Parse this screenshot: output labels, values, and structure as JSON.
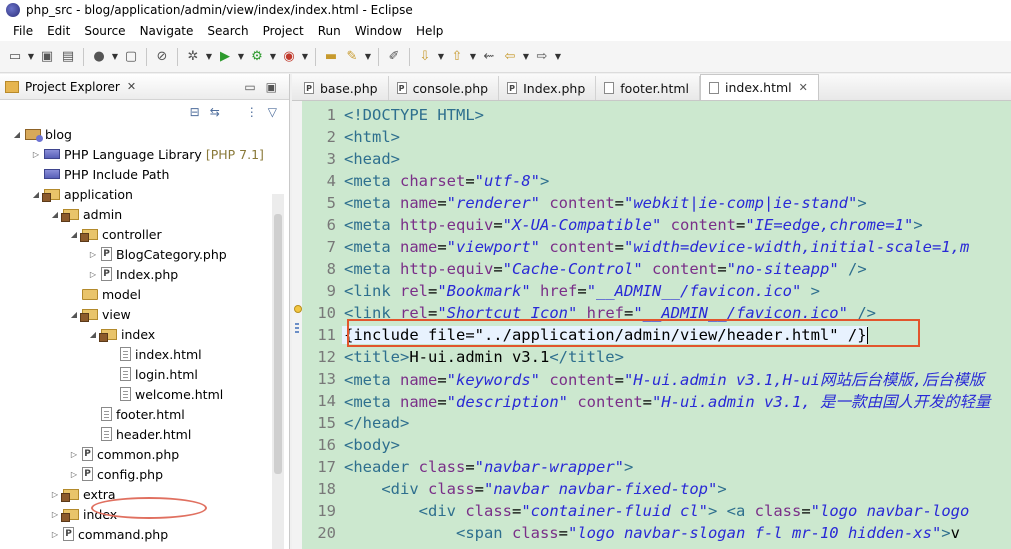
{
  "window": {
    "title": "php_src - blog/application/admin/view/index/index.html - Eclipse"
  },
  "menu": [
    "File",
    "Edit",
    "Source",
    "Navigate",
    "Search",
    "Project",
    "Run",
    "Window",
    "Help"
  ],
  "explorer": {
    "title": "Project Explorer",
    "tree": [
      {
        "label": "blog",
        "depth": 0,
        "expand": "open",
        "icon": "proj"
      },
      {
        "label": "PHP Language Library",
        "suffix": "[PHP 7.1]",
        "depth": 1,
        "expand": "closed",
        "icon": "lib"
      },
      {
        "label": "PHP Include Path",
        "depth": 1,
        "expand": "none",
        "icon": "lib"
      },
      {
        "label": "application",
        "depth": 1,
        "expand": "open",
        "icon": "pkg"
      },
      {
        "label": "admin",
        "depth": 2,
        "expand": "open",
        "icon": "pkg"
      },
      {
        "label": "controller",
        "depth": 3,
        "expand": "open",
        "icon": "pkg"
      },
      {
        "label": "BlogCategory.php",
        "depth": 4,
        "expand": "closed",
        "icon": "file-p"
      },
      {
        "label": "Index.php",
        "depth": 4,
        "expand": "closed",
        "icon": "file-p"
      },
      {
        "label": "model",
        "depth": 3,
        "expand": "none",
        "icon": "folder"
      },
      {
        "label": "view",
        "depth": 3,
        "expand": "open",
        "icon": "pkg"
      },
      {
        "label": "index",
        "depth": 4,
        "expand": "open",
        "icon": "pkg"
      },
      {
        "label": "index.html",
        "depth": 5,
        "expand": "none",
        "icon": "file-h"
      },
      {
        "label": "login.html",
        "depth": 5,
        "expand": "none",
        "icon": "file-h"
      },
      {
        "label": "welcome.html",
        "depth": 5,
        "expand": "none",
        "icon": "file-h"
      },
      {
        "label": "footer.html",
        "depth": 4,
        "expand": "none",
        "icon": "file-h"
      },
      {
        "label": "header.html",
        "depth": 4,
        "expand": "none",
        "icon": "file-h"
      },
      {
        "label": "common.php",
        "depth": 3,
        "expand": "closed",
        "icon": "file-p"
      },
      {
        "label": "config.php",
        "depth": 3,
        "expand": "closed",
        "icon": "file-p"
      },
      {
        "label": "extra",
        "depth": 2,
        "expand": "closed",
        "icon": "pkg"
      },
      {
        "label": "index",
        "depth": 2,
        "expand": "closed",
        "icon": "pkg"
      },
      {
        "label": "command.php",
        "depth": 2,
        "expand": "closed",
        "icon": "file-p"
      }
    ]
  },
  "editor": {
    "tabs": [
      {
        "label": "base.php",
        "icon": "file-p",
        "active": false
      },
      {
        "label": "console.php",
        "icon": "file-p",
        "active": false
      },
      {
        "label": "Index.php",
        "icon": "file-p",
        "active": false
      },
      {
        "label": "footer.html",
        "icon": "file-h",
        "active": false
      },
      {
        "label": "index.html",
        "icon": "file-h",
        "active": true
      }
    ],
    "current_line": 11,
    "lines": [
      [
        [
          "tag",
          "<!DOCTYPE HTML>"
        ]
      ],
      [
        [
          "tag",
          "<html>"
        ]
      ],
      [
        [
          "tag",
          "<head>"
        ]
      ],
      [
        [
          "tag",
          "<meta "
        ],
        [
          "attr",
          "charset"
        ],
        [
          "txt",
          "="
        ],
        [
          "val",
          "\"utf-8\""
        ],
        [
          "tag",
          ">"
        ]
      ],
      [
        [
          "tag",
          "<meta "
        ],
        [
          "attr",
          "name"
        ],
        [
          "txt",
          "="
        ],
        [
          "val",
          "\"renderer\""
        ],
        [
          "txt",
          " "
        ],
        [
          "attr",
          "content"
        ],
        [
          "txt",
          "="
        ],
        [
          "val",
          "\"webkit|ie-comp|ie-stand\""
        ],
        [
          "tag",
          ">"
        ]
      ],
      [
        [
          "tag",
          "<meta "
        ],
        [
          "attr",
          "http-equiv"
        ],
        [
          "txt",
          "="
        ],
        [
          "val",
          "\"X-UA-Compatible\""
        ],
        [
          "txt",
          " "
        ],
        [
          "attr",
          "content"
        ],
        [
          "txt",
          "="
        ],
        [
          "val",
          "\"IE=edge,chrome=1\""
        ],
        [
          "tag",
          ">"
        ]
      ],
      [
        [
          "tag",
          "<meta "
        ],
        [
          "attr",
          "name"
        ],
        [
          "txt",
          "="
        ],
        [
          "val",
          "\"viewport\""
        ],
        [
          "txt",
          " "
        ],
        [
          "attr",
          "content"
        ],
        [
          "txt",
          "="
        ],
        [
          "val",
          "\"width=device-width,initial-scale=1,m"
        ]
      ],
      [
        [
          "tag",
          "<meta "
        ],
        [
          "attr",
          "http-equiv"
        ],
        [
          "txt",
          "="
        ],
        [
          "val",
          "\"Cache-Control\""
        ],
        [
          "txt",
          " "
        ],
        [
          "attr",
          "content"
        ],
        [
          "txt",
          "="
        ],
        [
          "val",
          "\"no-siteapp\""
        ],
        [
          "txt",
          " "
        ],
        [
          "tag",
          "/>"
        ]
      ],
      [
        [
          "tag",
          "<link "
        ],
        [
          "attr",
          "rel"
        ],
        [
          "txt",
          "="
        ],
        [
          "val",
          "\"Bookmark\""
        ],
        [
          "txt",
          " "
        ],
        [
          "attr",
          "href"
        ],
        [
          "txt",
          "="
        ],
        [
          "val",
          "\"__ADMIN__/favicon.ico\""
        ],
        [
          "txt",
          " "
        ],
        [
          "tag",
          ">"
        ]
      ],
      [
        [
          "tag",
          "<link "
        ],
        [
          "attr",
          "rel"
        ],
        [
          "txt",
          "="
        ],
        [
          "val",
          "\"Shortcut Icon\""
        ],
        [
          "txt",
          " "
        ],
        [
          "attr",
          "href"
        ],
        [
          "txt",
          "="
        ],
        [
          "val",
          "\"__ADMIN__/favicon.ico\""
        ],
        [
          "txt",
          " "
        ],
        [
          "tag",
          "/>"
        ]
      ],
      [
        [
          "txt",
          "{include file=\"../application/admin/view/header.html\" /}"
        ]
      ],
      [
        [
          "tag",
          "<title>"
        ],
        [
          "txt",
          "H-ui.admin v3.1"
        ],
        [
          "tag",
          "</title>"
        ]
      ],
      [
        [
          "tag",
          "<meta "
        ],
        [
          "attr",
          "name"
        ],
        [
          "txt",
          "="
        ],
        [
          "val",
          "\"keywords\""
        ],
        [
          "txt",
          " "
        ],
        [
          "attr",
          "content"
        ],
        [
          "txt",
          "="
        ],
        [
          "val",
          "\"H-ui.admin v3.1,H-ui网站后台模版,后台模版"
        ]
      ],
      [
        [
          "tag",
          "<meta "
        ],
        [
          "attr",
          "name"
        ],
        [
          "txt",
          "="
        ],
        [
          "val",
          "\"description\""
        ],
        [
          "txt",
          " "
        ],
        [
          "attr",
          "content"
        ],
        [
          "txt",
          "="
        ],
        [
          "val",
          "\"H-ui.admin v3.1, 是一款由国人开发的轻量"
        ]
      ],
      [
        [
          "tag",
          "</head>"
        ]
      ],
      [
        [
          "tag",
          "<body>"
        ]
      ],
      [
        [
          "tag",
          "<header "
        ],
        [
          "attr",
          "class"
        ],
        [
          "txt",
          "="
        ],
        [
          "val",
          "\"navbar-wrapper\""
        ],
        [
          "tag",
          ">"
        ]
      ],
      [
        [
          "txt",
          "    "
        ],
        [
          "tag",
          "<div "
        ],
        [
          "attr",
          "class"
        ],
        [
          "txt",
          "="
        ],
        [
          "val",
          "\"navbar navbar-fixed-top\""
        ],
        [
          "tag",
          ">"
        ]
      ],
      [
        [
          "txt",
          "        "
        ],
        [
          "tag",
          "<div "
        ],
        [
          "attr",
          "class"
        ],
        [
          "txt",
          "="
        ],
        [
          "val",
          "\"container-fluid cl\""
        ],
        [
          "tag",
          "> <a "
        ],
        [
          "attr",
          "class"
        ],
        [
          "txt",
          "="
        ],
        [
          "val",
          "\"logo navbar-logo"
        ]
      ],
      [
        [
          "txt",
          "            "
        ],
        [
          "tag",
          "<span "
        ],
        [
          "attr",
          "class"
        ],
        [
          "txt",
          "="
        ],
        [
          "val",
          "\"logo navbar-slogan f-l mr-10 hidden-xs\""
        ],
        [
          "tag",
          ">"
        ],
        [
          "txt",
          "v"
        ]
      ]
    ]
  },
  "colors": {
    "editor_bg": "#cce8cf",
    "annotation": "#e2552d"
  }
}
